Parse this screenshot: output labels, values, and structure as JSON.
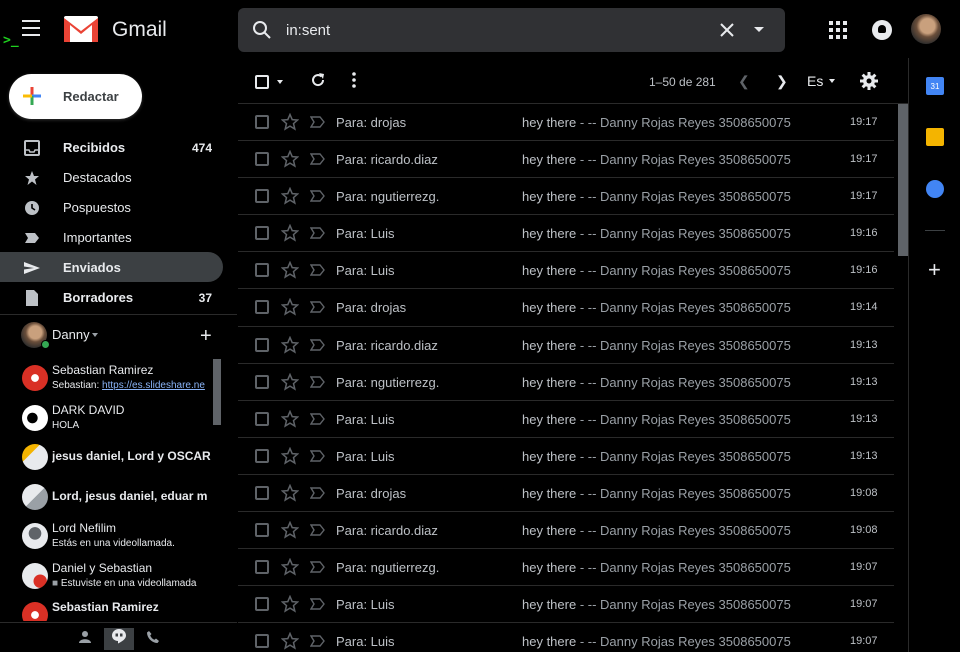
{
  "app": {
    "name": "Gmail"
  },
  "search": {
    "value": "in:sent"
  },
  "compose": {
    "label": "Redactar"
  },
  "nav": [
    {
      "label": "Recibidos",
      "count": "474",
      "icon": "inbox-icon",
      "bold": true
    },
    {
      "label": "Destacados",
      "count": "",
      "icon": "star-icon",
      "bold": false
    },
    {
      "label": "Pospuestos",
      "count": "",
      "icon": "clock-icon",
      "bold": false
    },
    {
      "label": "Importantes",
      "count": "",
      "icon": "important-icon",
      "bold": false
    },
    {
      "label": "Enviados",
      "count": "",
      "icon": "send-icon",
      "bold": true,
      "active": true
    },
    {
      "label": "Borradores",
      "count": "37",
      "icon": "draft-icon",
      "bold": true
    }
  ],
  "hangouts": {
    "user": "Danny",
    "chats": [
      {
        "name": "Sebastian Ramirez",
        "sub_prefix": "Sebastian: ",
        "sub_link": "https://es.slideshare.ne",
        "sub": ""
      },
      {
        "name": "DARK DAVID",
        "sub_prefix": "",
        "sub_link": "",
        "sub": "HOLA"
      },
      {
        "name": "jesus daniel, Lord y OSCAR",
        "sub_prefix": "",
        "sub_link": "",
        "sub": "",
        "big": true
      },
      {
        "name": "Lord, jesus daniel, eduar m",
        "sub_prefix": "",
        "sub_link": "",
        "sub": "",
        "big": true
      },
      {
        "name": "Lord Nefilim",
        "sub_prefix": "",
        "sub_link": "",
        "sub": "Estás en una videollamada."
      },
      {
        "name": "Daniel y Sebastian",
        "sub_prefix": "",
        "sub_link": "",
        "sub": "Estuviste en una videollamada"
      },
      {
        "name": "Sebastian Ramirez",
        "sub_prefix": "",
        "sub_link": "",
        "sub": ""
      }
    ]
  },
  "toolbar": {
    "range": "1–50 de 281",
    "lang": "Es"
  },
  "emails": [
    {
      "to": "Para: drojas",
      "subject": "hey there",
      "snippet": " - -- Danny Rojas Reyes 3508650075",
      "time": "19:17"
    },
    {
      "to": "Para: ricardo.diaz",
      "subject": "hey there",
      "snippet": " - -- Danny Rojas Reyes 3508650075",
      "time": "19:17"
    },
    {
      "to": "Para: ngutierrezg.",
      "subject": "hey there",
      "snippet": " - -- Danny Rojas Reyes 3508650075",
      "time": "19:17"
    },
    {
      "to": "Para: Luis",
      "subject": "hey there",
      "snippet": " - -- Danny Rojas Reyes 3508650075",
      "time": "19:16"
    },
    {
      "to": "Para: Luis",
      "subject": "hey there",
      "snippet": " - -- Danny Rojas Reyes 3508650075",
      "time": "19:16"
    },
    {
      "to": "Para: drojas",
      "subject": "hey there",
      "snippet": " - -- Danny Rojas Reyes 3508650075",
      "time": "19:14"
    },
    {
      "to": "Para: ricardo.diaz",
      "subject": "hey there",
      "snippet": " - -- Danny Rojas Reyes 3508650075",
      "time": "19:13"
    },
    {
      "to": "Para: ngutierrezg.",
      "subject": "hey there",
      "snippet": " - -- Danny Rojas Reyes 3508650075",
      "time": "19:13"
    },
    {
      "to": "Para: Luis",
      "subject": "hey there",
      "snippet": " - -- Danny Rojas Reyes 3508650075",
      "time": "19:13"
    },
    {
      "to": "Para: Luis",
      "subject": "hey there",
      "snippet": " - -- Danny Rojas Reyes 3508650075",
      "time": "19:13"
    },
    {
      "to": "Para: drojas",
      "subject": "hey there",
      "snippet": " - -- Danny Rojas Reyes 3508650075",
      "time": "19:08"
    },
    {
      "to": "Para: ricardo.diaz",
      "subject": "hey there",
      "snippet": " - -- Danny Rojas Reyes 3508650075",
      "time": "19:08"
    },
    {
      "to": "Para: ngutierrezg.",
      "subject": "hey there",
      "snippet": " - -- Danny Rojas Reyes 3508650075",
      "time": "19:07"
    },
    {
      "to": "Para: Luis",
      "subject": "hey there",
      "snippet": " - -- Danny Rojas Reyes 3508650075",
      "time": "19:07"
    },
    {
      "to": "Para: Luis",
      "subject": "hey there",
      "snippet": " - -- Danny Rojas Reyes 3508650075",
      "time": "19:07"
    }
  ],
  "right_panel": {
    "calendar_day": "31"
  },
  "colors": {
    "background": "#000000",
    "accent": "#8ab4f8",
    "active_nav": "#3c4043"
  }
}
